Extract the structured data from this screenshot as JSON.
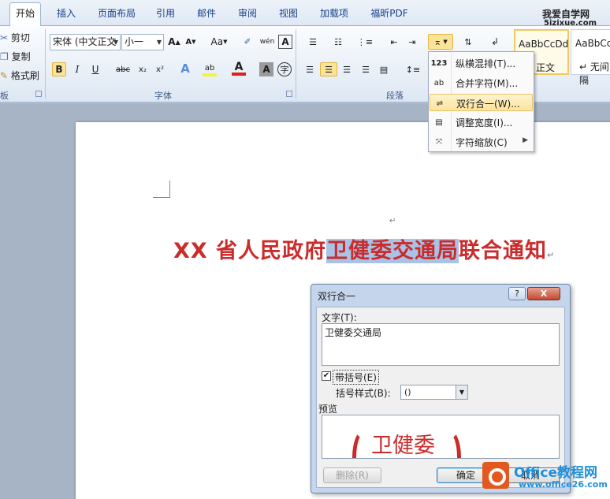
{
  "tabs": [
    {
      "label": "开始"
    },
    {
      "label": "插入"
    },
    {
      "label": "页面布局"
    },
    {
      "label": "引用"
    },
    {
      "label": "邮件"
    },
    {
      "label": "审阅"
    },
    {
      "label": "视图"
    },
    {
      "label": "加载项"
    },
    {
      "label": "福昕PDF"
    }
  ],
  "site": {
    "name": "我爱自学网",
    "url": "5izixue.com"
  },
  "clipboard": {
    "cut": "剪切",
    "copy": "复制",
    "format_painter": "格式刷",
    "group": "板"
  },
  "font": {
    "name": "宋体 (中文正文",
    "size": "小一",
    "group": "字体",
    "grow": "A",
    "shrink": "A",
    "case": "Aa",
    "pinyin": "wén",
    "bold": "B",
    "italic": "I",
    "underline": "U",
    "strike": "abc",
    "sub": "x₂",
    "sup": "x²",
    "text_effect": "A",
    "highlight": "ab",
    "font_color": "A",
    "shading": "A",
    "enclose": "字"
  },
  "paragraph": {
    "group": "段落"
  },
  "styles": [
    {
      "sample": "AaBbCcDd",
      "name": "正文"
    },
    {
      "sample": "AaBbCc",
      "name": "无间隔"
    }
  ],
  "menu": {
    "items": [
      {
        "icon": "123",
        "label": "纵横混排(T)..."
      },
      {
        "icon": "ab",
        "label": "合并字符(M)..."
      },
      {
        "icon": "",
        "label": "双行合一(W)..."
      },
      {
        "icon": "",
        "label": "调整宽度(I)..."
      },
      {
        "icon": "",
        "label": "字符缩放(C)"
      }
    ],
    "highlighted_index": 2
  },
  "document": {
    "title_prefix": "XX 省人民政府",
    "title_selected": "卫健委交通局",
    "title_suffix": "联合通知"
  },
  "dialog": {
    "title": "双行合一",
    "help": "?",
    "close": "X",
    "text_label": "文字(T):",
    "text_value": "卫健委交通局",
    "bracket_checkbox_label": "带括号(E)",
    "bracket_checked": true,
    "bracket_style_label": "括号样式(B):",
    "bracket_style_value": "()",
    "preview_label": "预览",
    "preview_text": "卫健委",
    "delete_button": "删除(R)",
    "ok_button": "确定",
    "cancel_button": "取消"
  },
  "watermark": {
    "brand": "Office教程网",
    "url": "www.office26.com"
  },
  "colors": {
    "title_red": "#cb2b2b",
    "selection_blue": "#a9c3e6",
    "menu_highlight": "#fde49b",
    "ribbon_blue": "#15428b"
  }
}
